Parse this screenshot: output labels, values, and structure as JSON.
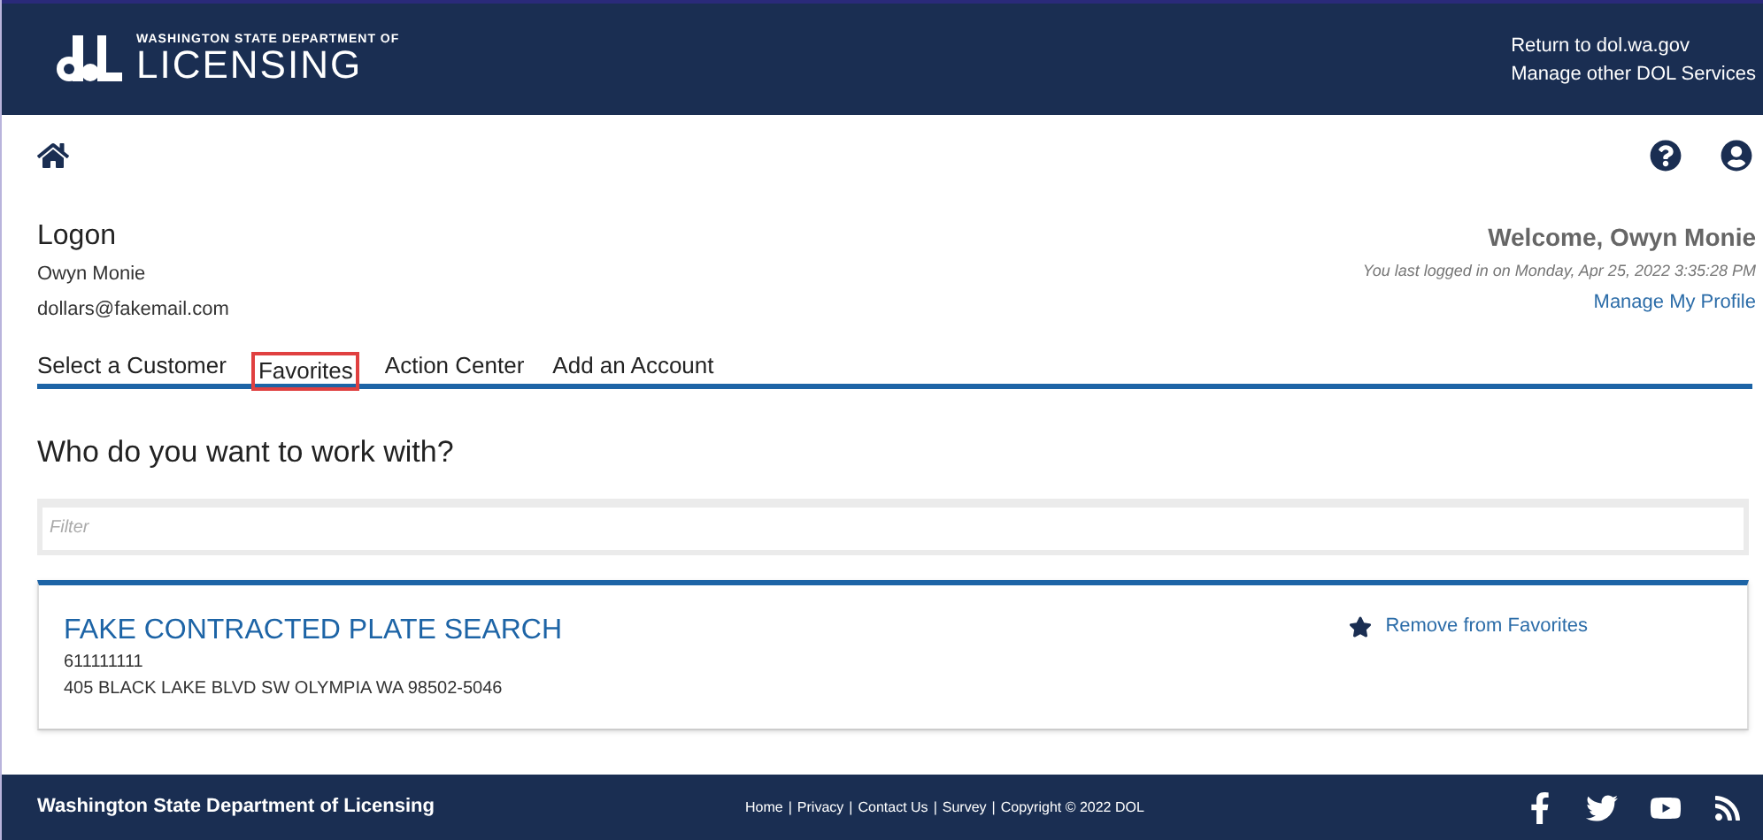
{
  "header": {
    "logo_small": "WASHINGTON STATE DEPARTMENT OF",
    "logo_large": "LICENSING",
    "links": [
      "Return to dol.wa.gov",
      "Manage other DOL Services"
    ]
  },
  "user": {
    "title": "Logon",
    "name": "Owyn Monie",
    "email": "dollars@fakemail.com",
    "welcome": "Welcome, Owyn Monie",
    "last_login": "You last logged in on Monday, Apr 25, 2022 3:35:28 PM",
    "profile_link": "Manage My Profile"
  },
  "tabs": [
    {
      "label": "Select a Customer",
      "selected": false
    },
    {
      "label": "Favorites",
      "selected": true
    },
    {
      "label": "Action Center",
      "selected": false
    },
    {
      "label": "Add an Account",
      "selected": false
    }
  ],
  "heading": "Who do you want to work with?",
  "filter": {
    "placeholder": "Filter"
  },
  "favorites": [
    {
      "name": "FAKE CONTRACTED PLATE SEARCH",
      "id": "611111111",
      "address": "405 BLACK LAKE BLVD SW OLYMPIA WA 98502-5046",
      "action": "Remove from Favorites"
    }
  ],
  "footer": {
    "title": "Washington State Department of Licensing",
    "links": [
      "Home",
      "Privacy",
      "Contact Us",
      "Survey"
    ],
    "separator": "|",
    "copyright": "Copyright © 2022 DOL"
  }
}
